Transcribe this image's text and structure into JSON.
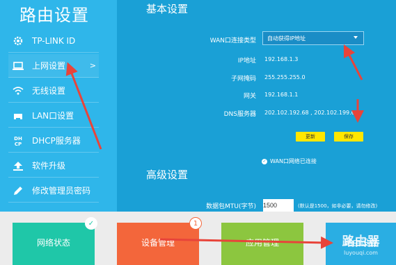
{
  "sidebar": {
    "title": "路由设置",
    "items": [
      {
        "label": "TP-LINK ID",
        "icon": "gear-icon"
      },
      {
        "label": "上网设置",
        "icon": "monitor-icon",
        "arrow": ">"
      },
      {
        "label": "无线设置",
        "icon": "wifi-icon"
      },
      {
        "label": "LAN口设置",
        "icon": "lan-icon"
      },
      {
        "label": "DHCP服务器",
        "icon": "dhcp-icon"
      },
      {
        "label": "软件升级",
        "icon": "upgrade-icon"
      },
      {
        "label": "修改管理员密码",
        "icon": "pencil-icon"
      }
    ]
  },
  "basic": {
    "title": "基本设置",
    "wan_type_label": "WAN口连接类型",
    "wan_type_value": "自动获得IP地址",
    "ip_label": "IP地址",
    "ip_value": "192.168.1.3",
    "mask_label": "子网掩码",
    "mask_value": "255.255.255.0",
    "gateway_label": "网关",
    "gateway_value": "192.168.1.1",
    "dns_label": "DNS服务器",
    "dns_value": "202.102.192.68 , 202.102.199.68",
    "update_button": "更新",
    "save_button": "保存",
    "status_text": "WAN口网络已连接"
  },
  "advanced": {
    "title": "高级设置",
    "mtu_label": "数据包MTU(字节)",
    "mtu_value": "1500",
    "mtu_hint": "(默认是1500，如非必要，请勿修改)"
  },
  "tiles": [
    {
      "label": "网络状态",
      "color": "#1fc7a8",
      "badge": "✓"
    },
    {
      "label": "设备管理",
      "color": "#f3663b",
      "badge": "1"
    },
    {
      "label": "应用管理",
      "color": "#8cc63f"
    },
    {
      "label": "路由设置",
      "color": "#2aaee3"
    }
  ],
  "watermark": {
    "line1": "路由器",
    "line2": "luyouqi.com"
  },
  "colors": {
    "accent": "#2aaee3",
    "button": "#ffe600",
    "arrow": "#e8443a"
  }
}
